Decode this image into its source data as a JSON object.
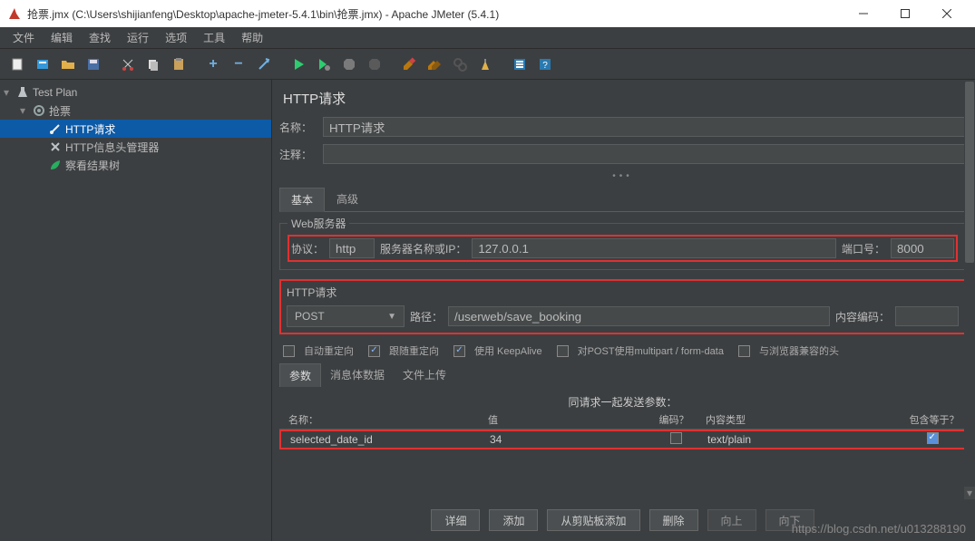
{
  "titlebar": {
    "title": "抢票.jmx (C:\\Users\\shijianfeng\\Desktop\\apache-jmeter-5.4.1\\bin\\抢票.jmx) - Apache JMeter (5.4.1)"
  },
  "menu": {
    "file": "文件",
    "edit": "编辑",
    "search": "查找",
    "run": "运行",
    "options": "选项",
    "tools": "工具",
    "help": "帮助"
  },
  "tree": {
    "root": "Test Plan",
    "node1": "抢票",
    "node2": "HTTP请求",
    "node3": "HTTP信息头管理器",
    "node4": "察看结果树"
  },
  "panel": {
    "title": "HTTP请求",
    "name_label": "名称：",
    "name_value": "HTTP请求",
    "comment_label": "注释："
  },
  "tabs": {
    "basic": "基本",
    "advanced": "高级"
  },
  "web": {
    "legend": "Web服务器",
    "protocol_label": "协议：",
    "protocol_value": "http",
    "server_label": "服务器名称或IP：",
    "server_value": "127.0.0.1",
    "port_label": "端口号：",
    "port_value": "8000"
  },
  "req": {
    "legend": "HTTP请求",
    "method": "POST",
    "path_label": "路径：",
    "path_value": "/userweb/save_booking",
    "encoding_label": "内容编码："
  },
  "checks": {
    "auto_redirect": "自动重定向",
    "follow_redirect": "跟随重定向",
    "keepalive": "使用 KeepAlive",
    "multipart": "对POST使用multipart / form-data",
    "browser_headers": "与浏览器兼容的头"
  },
  "subtabs": {
    "params": "参数",
    "body": "消息体数据",
    "upload": "文件上传"
  },
  "table": {
    "title": "同请求一起发送参数：",
    "h_name": "名称：",
    "h_value": "值",
    "h_encode": "编码？",
    "h_content_type": "内容类型",
    "h_include": "包含等于？",
    "row0": {
      "name": "selected_date_id",
      "value": "34",
      "content_type": "text/plain"
    }
  },
  "buttons": {
    "detail": "详细",
    "add": "添加",
    "from_clipboard": "从剪贴板添加",
    "delete": "删除",
    "up": "向上",
    "down": "向下"
  },
  "watermark": "https://blog.csdn.net/u013288190"
}
